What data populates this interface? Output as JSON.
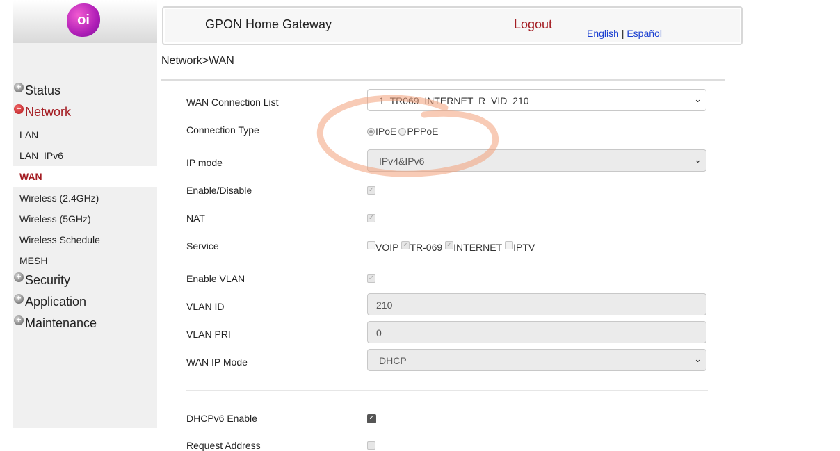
{
  "brand": {
    "logo_text": "oi"
  },
  "header": {
    "title": "GPON Home Gateway",
    "logout": "Logout",
    "lang_english": "English",
    "lang_separator": "|",
    "lang_spanish": "Español"
  },
  "breadcrumb": "Network>WAN",
  "sidebar": {
    "status": "Status",
    "network": "Network",
    "network_items": [
      "LAN",
      "LAN_IPv6",
      "WAN",
      "Wireless (2.4GHz)",
      "Wireless (5GHz)",
      "Wireless Schedule",
      "MESH"
    ],
    "security": "Security",
    "application": "Application",
    "maintenance": "Maintenance"
  },
  "form": {
    "wan_connection_list": {
      "label": "WAN Connection List",
      "value": "1_TR069_INTERNET_R_VID_210"
    },
    "connection_type": {
      "label": "Connection Type",
      "options": [
        "IPoE",
        "PPPoE"
      ],
      "selected": "IPoE"
    },
    "ip_mode": {
      "label": "IP mode",
      "value": "IPv4&IPv6"
    },
    "enable_disable": {
      "label": "Enable/Disable",
      "checked": true
    },
    "nat": {
      "label": "NAT",
      "checked": true
    },
    "service": {
      "label": "Service",
      "options": [
        {
          "name": "VOIP",
          "checked": false
        },
        {
          "name": "TR-069",
          "checked": true
        },
        {
          "name": "INTERNET",
          "checked": true
        },
        {
          "name": "IPTV",
          "checked": false
        }
      ]
    },
    "enable_vlan": {
      "label": "Enable VLAN",
      "checked": true
    },
    "vlan_id": {
      "label": "VLAN ID",
      "value": "210"
    },
    "vlan_pri": {
      "label": "VLAN PRI",
      "value": "0"
    },
    "wan_ip_mode": {
      "label": "WAN IP Mode",
      "value": "DHCP"
    },
    "dhcpv6_enable": {
      "label": "DHCPv6 Enable",
      "checked": true
    },
    "request_address": {
      "label": "Request Address"
    }
  },
  "icons": {
    "expand": "plus-circle-icon",
    "collapse": "minus-circle-icon",
    "dropdown": "chevron-down-icon",
    "check": "checkmark-icon"
  },
  "colors": {
    "accent": "#a41d23",
    "link": "#1a3fd1",
    "annotation": "#f3a07a"
  }
}
